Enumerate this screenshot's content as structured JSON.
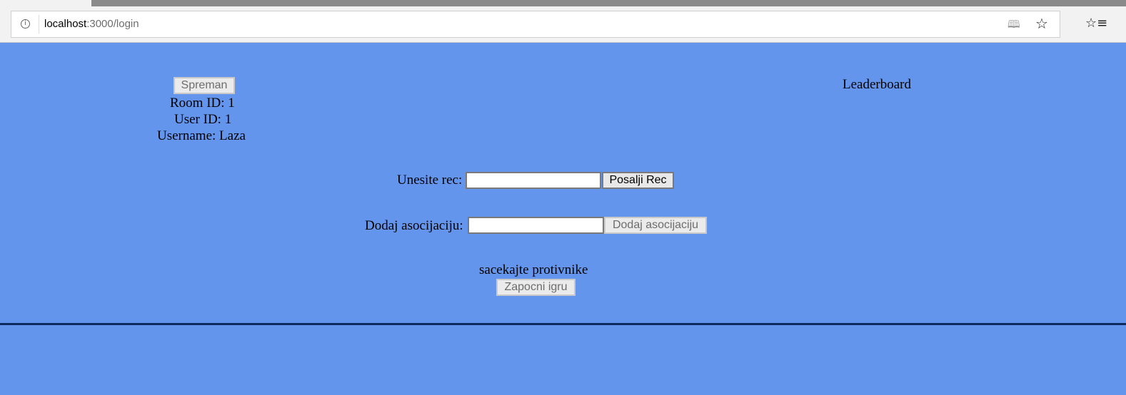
{
  "browser": {
    "url_host": "localhost",
    "url_rest": ":3000/login",
    "icons": [
      "info-icon",
      "reading-view-icon",
      "star-icon",
      "favorites-icon"
    ]
  },
  "left_panel": {
    "ready_button": "Spreman",
    "room_id": "Room ID: 1",
    "user_id": "User ID: 1",
    "username": "Username: Laza"
  },
  "leaderboard": {
    "title": "Leaderboard"
  },
  "word_form": {
    "label": "Unesite rec:",
    "value": "",
    "button": "Posalji Rec"
  },
  "association_form": {
    "label": "Dodaj asocijaciju:",
    "value": "",
    "button": "Dodaj asocijaciju"
  },
  "status": {
    "message": "sacekajte protivnike",
    "start_button": "Zapocni igru"
  },
  "colors": {
    "page_background": "#6495ed",
    "divider": "#0f2a5e"
  }
}
